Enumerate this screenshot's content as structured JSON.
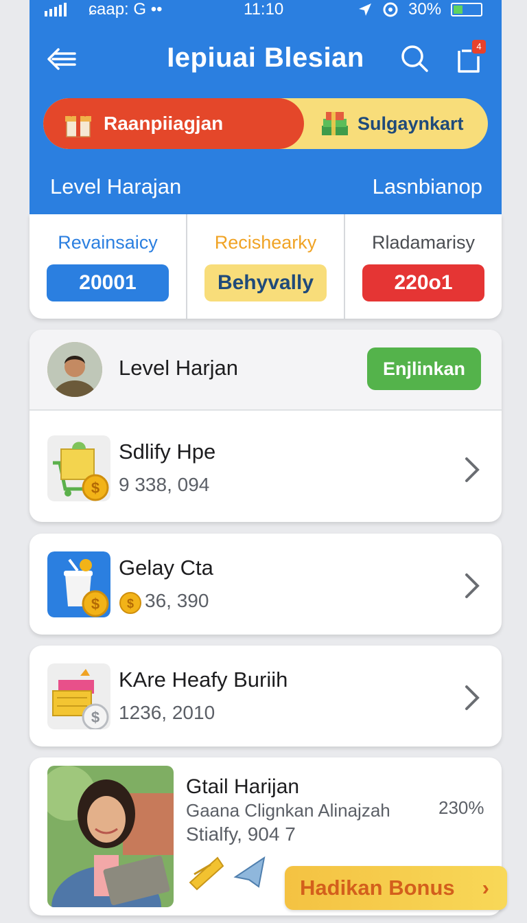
{
  "status_bar": {
    "carrier": "ɕaap: G ••",
    "time": "11:10",
    "battery": "30%"
  },
  "header": {
    "title": "Iepiuai Blesian",
    "notification_count": "4",
    "segment_left": "Raanpiiagjan",
    "segment_right": "Sulgaynkart",
    "level_label": "Level Harajan",
    "level_right": "Lasnbianop"
  },
  "stats": [
    {
      "label": "Revainsaicy",
      "value": "20001",
      "label_color": "#2b7fe0",
      "bg": "#2b7fe0",
      "fg": "#ffffff"
    },
    {
      "label": "Recishearky",
      "value": "Behyvally",
      "label_color": "#f0a325",
      "bg": "#f8dd7a",
      "fg": "#1f4a7a"
    },
    {
      "label": "Rladamarisy",
      "value": "220o1",
      "label_color": "#4a4d52",
      "bg": "#e53534",
      "fg": "#ffffff"
    }
  ],
  "profile": {
    "name": "Level Harjan",
    "button": "Enjlinkan"
  },
  "items": [
    {
      "title": "Sdlify Hpe",
      "amount": "9 338, 094"
    },
    {
      "title": "Gelay Cta",
      "amount": "36, 390"
    },
    {
      "title": "KAre Heafy Buriih",
      "amount": "1236, 2010"
    }
  ],
  "promo": {
    "title": "Gtail Harijan",
    "subtitle": "Gaana Clignkan Alinajzah",
    "percent": "230%",
    "amount": "Stialfy, 904 7",
    "button": "Hadikan Bonus",
    "button_arrow": "›"
  },
  "colors": {
    "primary": "#2b7fe0",
    "accent_red": "#e4472a",
    "accent_yellow": "#f8dd7a",
    "success": "#54b34b"
  }
}
